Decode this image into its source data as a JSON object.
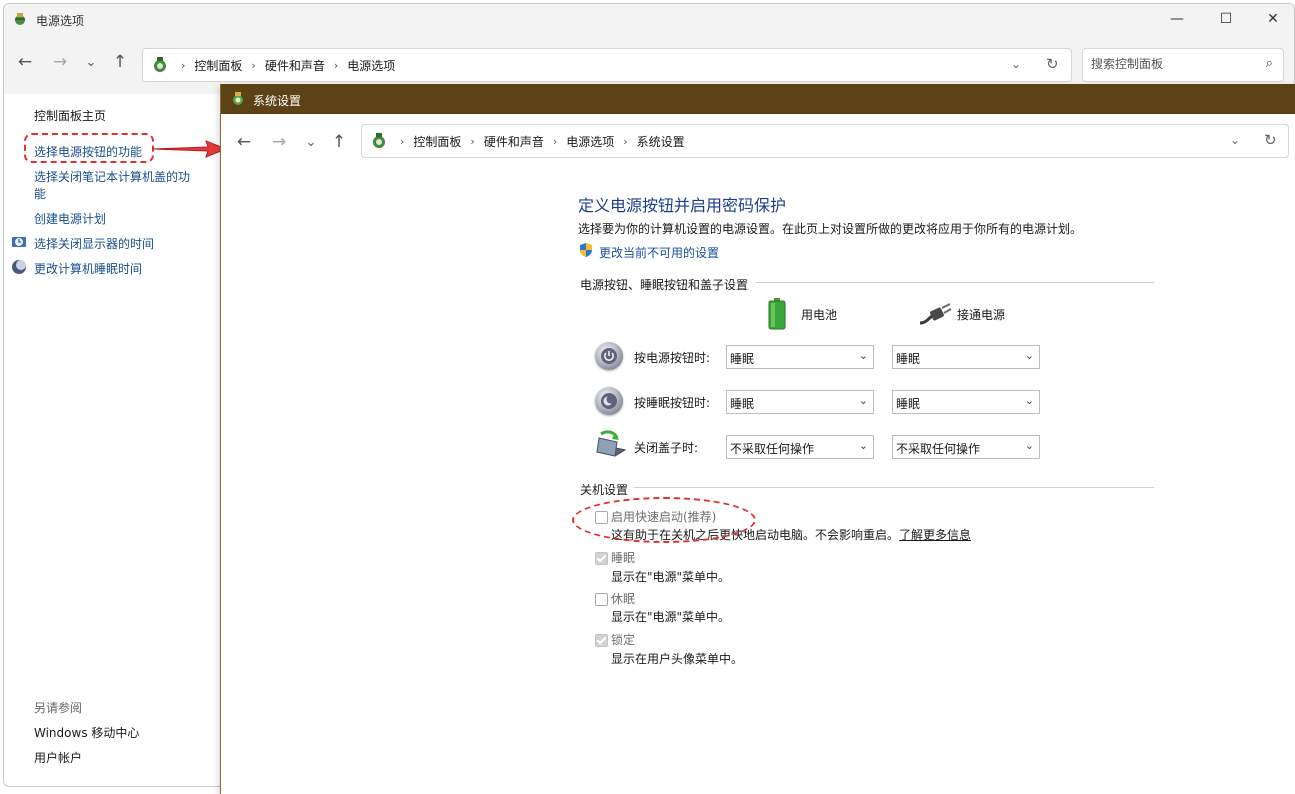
{
  "outer": {
    "title": "电源选项",
    "nav": {
      "back": "←",
      "forward": "→",
      "recent": "⌄",
      "up": "↑"
    },
    "breadcrumbs": [
      "控制面板",
      "硬件和声音",
      "电源选项"
    ],
    "search_placeholder": "搜索控制面板",
    "window_controls": {
      "minimize": "—",
      "maximize": "☐",
      "close": "✕"
    }
  },
  "sidebar": {
    "home": "控制面板主页",
    "links": [
      {
        "label": "选择电源按钮的功能"
      },
      {
        "label": "选择关闭笔记本计算机盖的功",
        "label2": "能"
      },
      {
        "label": "创建电源计划"
      },
      {
        "label": "选择关闭显示器的时间",
        "icon": "monitor-clock-icon"
      },
      {
        "label": "更改计算机睡眠时间",
        "icon": "moon-icon"
      }
    ],
    "see_also_heading": "另请参阅",
    "see_also": [
      "Windows 移动中心",
      "用户帐户"
    ]
  },
  "inner": {
    "title": "系统设置",
    "breadcrumbs": [
      "控制面板",
      "硬件和声音",
      "电源选项",
      "系统设置"
    ],
    "heading": "定义电源按钮并启用密码保护",
    "description": "选择要为你的计算机设置的电源设置。在此页上对设置所做的更改将应用于你所有的电源计划。",
    "change_link": "更改当前不可用的设置",
    "buttons_group": {
      "title": "电源按钮、睡眠按钮和盖子设置",
      "col_battery": "用电池",
      "col_plugged": "接通电源",
      "rows": [
        {
          "label": "按电源按钮时:",
          "battery": "睡眠",
          "plugged": "睡眠",
          "icon": "power-button-icon"
        },
        {
          "label": "按睡眠按钮时:",
          "battery": "睡眠",
          "plugged": "睡眠",
          "icon": "sleep-button-icon"
        },
        {
          "label": "关闭盖子时:",
          "battery": "不采取任何操作",
          "plugged": "不采取任何操作",
          "icon": "laptop-lid-icon"
        }
      ]
    },
    "shutdown_group": {
      "title": "关机设置",
      "items": [
        {
          "label": "启用快速启动(推荐)",
          "checked": false,
          "desc": "这有助于在关机之后更快地启动电脑。不会影响重启。",
          "link": "了解更多信息"
        },
        {
          "label": "睡眠",
          "checked": true,
          "desc": "显示在\"电源\"菜单中。"
        },
        {
          "label": "休眠",
          "checked": false,
          "desc": "显示在\"电源\"菜单中。"
        },
        {
          "label": "锁定",
          "checked": true,
          "desc": "显示在用户头像菜单中。"
        }
      ]
    }
  },
  "colors": {
    "inner_titlebar": "#5c4214",
    "link": "#1a4f8f",
    "heading": "#1e3d8f",
    "annotation": "#e03030"
  }
}
